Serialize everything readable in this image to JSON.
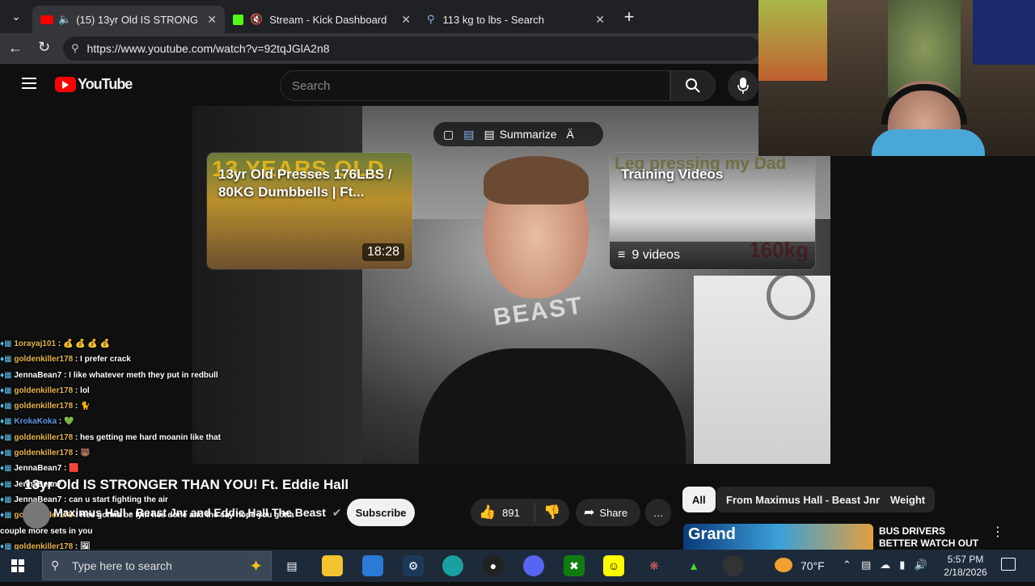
{
  "browser": {
    "tabs": [
      {
        "title": "(15) 13yr Old IS STRONGER TH",
        "active": true
      },
      {
        "title": "Stream - Kick Dashboard",
        "active": false
      },
      {
        "title": "113 kg to lbs - Search",
        "active": false
      }
    ],
    "url": "https://www.youtube.com/watch?v=92tqJGlA2n8"
  },
  "youtube": {
    "logo_text": "YouTube",
    "search_placeholder": "Search"
  },
  "player": {
    "summarize_label": "Summarize",
    "shirt_text": "BEAST",
    "end_card_video": {
      "title": "13yr Old Presses 176LBS / 80KG Dumbbells | Ft...",
      "thumb_text": "13 YEARS OLD",
      "duration": "18:28"
    },
    "end_card_playlist": {
      "title": "Training Videos",
      "thumb_text": "Leg pressing my Dad",
      "weight_text": "160kg",
      "count": "9 videos"
    }
  },
  "video": {
    "title": "13yr Old IS STRONGER THAN YOU! Ft. Eddie Hall",
    "channel": "Maximus Hall - Beast Jnr and Eddie Hall The Beast",
    "subscribe_label": "Subscribe",
    "likes": "891",
    "share_label": "Share"
  },
  "chips": [
    "All",
    "From Maximus Hall - Beast Jnr",
    "Weight"
  ],
  "recommendation": {
    "title": "BUS DRIVERS BETTER WATCH OUT TODAY!",
    "thumb_text": "Grand"
  },
  "chat": [
    {
      "user": "1orayaj101",
      "msg": "💰 💰 💰 💰",
      "cls": "u"
    },
    {
      "user": "goldenkiller178",
      "msg": "I prefer crack",
      "cls": "u"
    },
    {
      "user": "JennaBean7",
      "msg": "I like whatever meth they put in redbull",
      "cls": "u2"
    },
    {
      "user": "goldenkiller178",
      "msg": "lol",
      "cls": "u"
    },
    {
      "user": "goldenkiller178",
      "msg": "🐈",
      "cls": "u"
    },
    {
      "user": "KrokaKoka",
      "msg": "💚",
      "cls": "u3"
    },
    {
      "user": "goldenkiller178",
      "msg": "hes getting me hard moanin like that",
      "cls": "u"
    },
    {
      "user": "goldenkiller178",
      "msg": "🐻",
      "cls": "u"
    },
    {
      "user": "JennaBean7",
      "msg": "🟥",
      "cls": "u2"
    },
    {
      "user": "JennaBean7",
      "msg": "",
      "cls": "u2"
    },
    {
      "user": "JennaBean7",
      "msg": "can u start fighting the air",
      "cls": "u2"
    },
    {
      "user": "goldenkiller178",
      "msg": "Hes gonna be lyin hes done and the say nope you gotta",
      "cls": "u"
    },
    {
      "user": "",
      "msg": "couple more sets in you",
      "cls": "m"
    },
    {
      "user": "goldenkiller178",
      "msg": "🖼",
      "cls": "u"
    },
    {
      "user": "JennaBean7",
      "msg": "🟥",
      "cls": "u2"
    },
    {
      "user": "1orayaj101",
      "msg": "",
      "cls": "u"
    }
  ],
  "taskbar": {
    "search_placeholder": "Type here to search",
    "weather": "70°F",
    "time": "5:57 PM",
    "date": "2/18/2026"
  }
}
